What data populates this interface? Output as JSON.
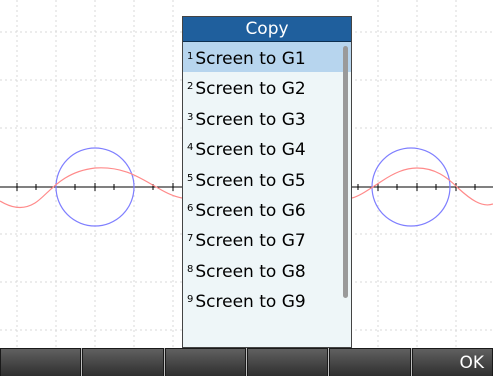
{
  "menu": {
    "title": "Copy",
    "selected_index": 0,
    "items": [
      {
        "num": "1",
        "label": "Screen to G1"
      },
      {
        "num": "2",
        "label": "Screen to G2"
      },
      {
        "num": "3",
        "label": "Screen to G3"
      },
      {
        "num": "4",
        "label": "Screen to G4"
      },
      {
        "num": "5",
        "label": "Screen to G5"
      },
      {
        "num": "6",
        "label": "Screen to G6"
      },
      {
        "num": "7",
        "label": "Screen to G7"
      },
      {
        "num": "8",
        "label": "Screen to G8"
      },
      {
        "num": "9",
        "label": "Screen to G9"
      }
    ]
  },
  "softkeys": [
    "",
    "",
    "",
    "",
    "",
    "OK"
  ],
  "colors": {
    "menu_title_bg": "#1f5f9d",
    "menu_selected_bg": "#b7d5ee",
    "menu_bg": "#eef6f8",
    "circle_curve": "#7f7fff",
    "sine_curve": "#ff8a8a",
    "grid": "#d8d8d8",
    "softkey_bg": "#3f3f3f"
  }
}
